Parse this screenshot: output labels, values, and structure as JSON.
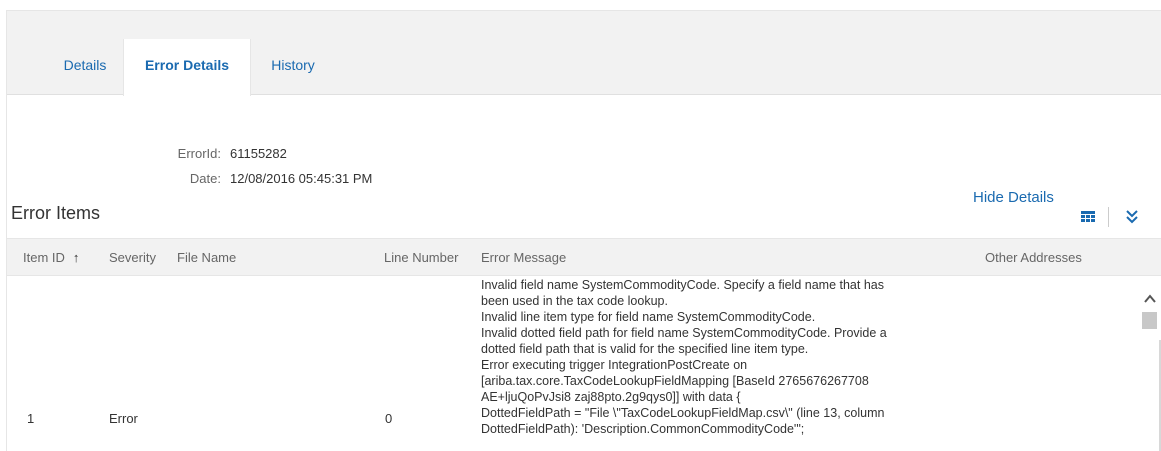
{
  "tabs": [
    {
      "label": "Details"
    },
    {
      "label": "Error Details"
    },
    {
      "label": "History"
    }
  ],
  "error_info": {
    "error_id_label": "ErrorId:",
    "error_id_value": "61155282",
    "date_label": "Date:",
    "date_value": "12/08/2016 05:45:31 PM"
  },
  "section": {
    "title": "Error Items",
    "hide_details": "Hide Details"
  },
  "table": {
    "columns": [
      "Item ID",
      "Severity",
      "File Name",
      "Line Number",
      "Error Message",
      "Other Addresses"
    ],
    "sort_indicator": "↑",
    "rows": [
      {
        "item_id": "1",
        "severity": "Error",
        "file_name": "",
        "line_number": "0",
        "message_lines": [
          "Invalid field name SystemCommodityCode. Specify a field name that has",
          "been used in the tax code lookup.",
          "Invalid line item type for field name SystemCommodityCode.",
          "Invalid dotted field path for field name SystemCommodityCode. Provide a",
          "dotted field path that is valid for the specified line item type.",
          "Error executing trigger IntegrationPostCreate on",
          "[ariba.tax.core.TaxCodeLookupFieldMapping [BaseId 2765676267708",
          "AE+ljuQoPvJsi8 zaj88pto.2g9qys0]] with data {",
          "DottedFieldPath = \"File \\\"TaxCodeLookupFieldMap.csv\\\" (line 13, column",
          "DottedFieldPath): 'Description.CommonCommodityCode'\";"
        ],
        "other_addresses": ""
      }
    ]
  },
  "icons": {
    "grid": "table-grid-icon",
    "collapse": "double-chevron-down-icon",
    "scroll_up": "scroll-up-arrow-icon"
  },
  "colors": {
    "link": "#1a6ab0",
    "header_bg": "#f2f2f2"
  }
}
